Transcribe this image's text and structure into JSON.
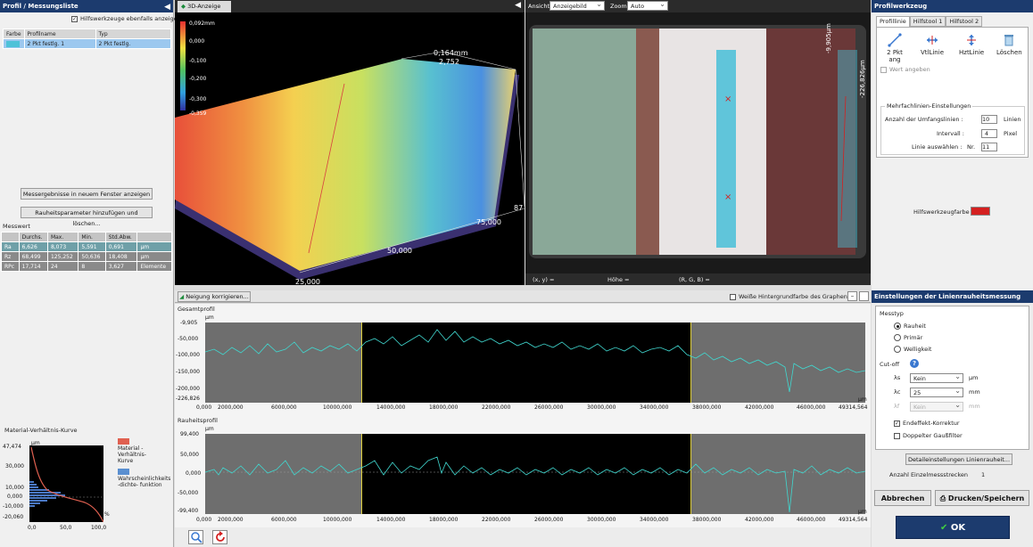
{
  "left_panel": {
    "header": "Profil / Messungsliste",
    "aux_checkbox": "Hilfswerkzeuge ebenfalls anzeigen",
    "profile_table": {
      "headers": [
        "Farbe",
        "Profilname",
        "Typ"
      ],
      "rows": [
        {
          "name": "2 Pkt festlg. 1",
          "type": "2 Pkt festlg."
        }
      ]
    },
    "btn_new_window": "Messergebnisse in neuem Fenster anzeigen",
    "btn_roughness": "Rauheitsparameter hinzufügen und löschen...",
    "measure_label": "Messwert",
    "measure_table": {
      "headers": [
        "",
        "Durchs.",
        "Max.",
        "Min.",
        "Std.Abw.",
        ""
      ],
      "rows": [
        [
          "Ra",
          "6,626",
          "8,073",
          "5,591",
          "0,691",
          "µm"
        ],
        [
          "Rz",
          "68,499",
          "125,252",
          "50,636",
          "18,408",
          "µm"
        ],
        [
          "RPc",
          "17,714",
          "24",
          "8",
          "3,627",
          "Elemente"
        ]
      ]
    },
    "mat_curve_label": "Material-Verhältnis-Kurve",
    "mat_chart": {
      "unit": "µm",
      "yticks": [
        "47,474",
        "30,000",
        "10,000",
        "0,000",
        "-10,000",
        "-20,060"
      ],
      "xticks": [
        "0,0",
        "50,0",
        "100,0"
      ],
      "xunit": "%",
      "legend1": "Material -Verhältnis- Kurve",
      "legend2": "Wahrscheinlichkeits -dichte- funktion",
      "color1": "#e06050",
      "color2": "#5a8fd0"
    }
  },
  "view3d": {
    "tab": "3D-Anzeige",
    "scale": [
      "0,092mm",
      "0,000",
      "-0,100",
      "-0,200",
      "-0,300",
      "-0,359"
    ],
    "axis_labels": [
      "0,164mm",
      "2,752",
      "87",
      "75,000",
      "50,000",
      "25,000"
    ]
  },
  "view2d": {
    "ansicht_label": "Ansicht",
    "ansicht_value": "Anzeigebild",
    "zoom_label": "Zoom",
    "zoom_value": "Auto",
    "dim1": "-9,905µm",
    "dim2": "-226,826µm",
    "status_xy": "(x, y)  =",
    "status_hoehe": "Höhe  =",
    "status_rgb": "(R, G, B)  ="
  },
  "profile_tool": {
    "header": "Profilwerkzeug",
    "tabs": [
      "Profillinie",
      "Hilfstool 1",
      "Hilfstool 2"
    ],
    "tools": [
      "2 Pkt ang",
      "VtlLinie",
      "HztLinie",
      "Löschen"
    ],
    "wert_angeben": "Wert angeben",
    "multi_title": "Mehrfachlinien-Einstellungen",
    "count_label": "Anzahl der Umfangslinien :",
    "count_value": "10",
    "count_unit": "Linien",
    "interval_label": "Intervall :",
    "interval_value": "4",
    "interval_unit": "Pixel",
    "select_label": "Linie auswählen :",
    "select_prefix": "Nr.",
    "select_value": "11",
    "aux_color_label": "Hilfswerkzeugfarbe",
    "aux_color": "#d42020"
  },
  "graph_toolbar": {
    "tilt_button": "Neigung korrigieren...",
    "white_bg": "Weiße Hintergrundfarbe des Graphen"
  },
  "gesamt": {
    "title": "Gesamtprofil",
    "unit": "µm",
    "yticks": [
      "-9,905",
      "-50,000",
      "-100,000",
      "-150,000",
      "-200,000",
      "-226,826"
    ],
    "xticks": [
      "0,000",
      "2000,000",
      "6000,000",
      "10000,000",
      "14000,000",
      "18000,000",
      "22000,000",
      "26000,000",
      "30000,000",
      "34000,000",
      "38000,000",
      "42000,000",
      "46000,000",
      "49314,564"
    ],
    "xunit": "µm"
  },
  "rauheit": {
    "title": "Rauheitsprofil",
    "unit": "µm",
    "yticks": [
      "99,400",
      "50,000",
      "0,000",
      "-50,000",
      "-99,400"
    ],
    "xticks": [
      "0,000",
      "2000,000",
      "6000,000",
      "10000,000",
      "14000,000",
      "18000,000",
      "22000,000",
      "26000,000",
      "30000,000",
      "34000,000",
      "38000,000",
      "42000,000",
      "46000,000",
      "49314,564"
    ],
    "xunit": "µm"
  },
  "line_settings": {
    "header": "Einstellungen der Linienrauheitsmessung",
    "messtyp": "Messtyp",
    "options": [
      "Rauheit",
      "Primär",
      "Welligkeit"
    ],
    "cutoff": "Cut-off",
    "ls_label": "λs",
    "ls_value": "Kein",
    "ls_unit": "µm",
    "lc_label": "λc",
    "lc_value": "25",
    "lc_unit": "mm",
    "lf_label": "λf",
    "lf_value": "Kein",
    "lf_unit": "mm",
    "end_effect": "Endeffekt-Korrektur",
    "double_gauss": "Doppelter Gaußfilter",
    "detail_button": "Detaileinstellungen Linienrauheit...",
    "count_label": "Anzahl Einzelmessstrecken",
    "count_value": "1"
  },
  "actions": {
    "cancel": "Abbrechen",
    "print": "Drucken/Speichern",
    "ok": "OK"
  }
}
